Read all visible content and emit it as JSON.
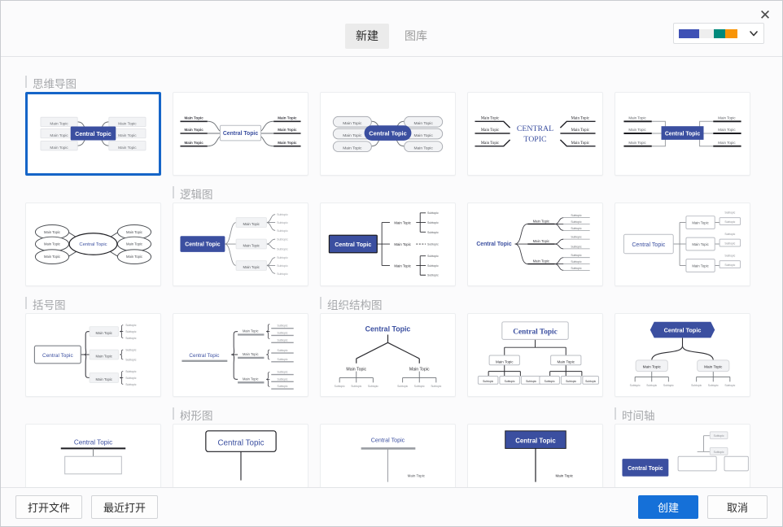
{
  "window": {
    "close_label": "✕"
  },
  "header": {
    "tabs": [
      {
        "label": "新建",
        "active": true
      },
      {
        "label": "图库",
        "active": false
      }
    ],
    "theme_picker": {
      "name": "theme-color-picker",
      "swatches": [
        "#3f51b5",
        "#eeeeee",
        "#00897b",
        "#f89406"
      ],
      "chevron": "⌄"
    }
  },
  "sections": [
    {
      "label": "思维导图"
    },
    {
      "label": "逻辑图"
    },
    {
      "label": "括号图"
    },
    {
      "label": "组织结构图"
    },
    {
      "label": "树形图"
    },
    {
      "label": "时间轴"
    }
  ],
  "labels": {
    "central": "Central Topic",
    "central_upper_line1": "CENTRAL",
    "central_upper_line2": "TOPIC",
    "main": "Main Topic",
    "sub": "Subtopic"
  },
  "colors": {
    "accent_blue": "#3b4fa0",
    "text_blue": "#3b4fa0",
    "primary_button": "#1570d8",
    "selection_border": "#1565c8",
    "node_gray": "#f2f3f5",
    "line_gray": "#8a8d92"
  },
  "templates": {
    "row1": [
      {
        "name": "mindmap-classic-filled",
        "selected": true
      },
      {
        "name": "mindmap-underline-boxed",
        "selected": false
      },
      {
        "name": "mindmap-rounded-pill",
        "selected": false
      },
      {
        "name": "mindmap-serif-plain",
        "selected": false
      },
      {
        "name": "mindmap-orthogonal-underline",
        "selected": false
      }
    ],
    "row2": [
      {
        "name": "logic-ellipse-radial",
        "selected": false
      },
      {
        "name": "logic-right-branch-boxed",
        "selected": false
      },
      {
        "name": "logic-right-branch-square",
        "selected": false
      },
      {
        "name": "logic-right-branch-underline",
        "selected": false
      },
      {
        "name": "logic-right-branch-outline",
        "selected": false
      }
    ],
    "row3": [
      {
        "name": "bracket-boxed",
        "selected": false
      },
      {
        "name": "bracket-underline",
        "selected": false
      },
      {
        "name": "org-plain-topdown",
        "selected": false
      },
      {
        "name": "org-boxed-topdown",
        "selected": false
      },
      {
        "name": "org-filled-hex-topdown",
        "selected": false
      }
    ],
    "row4": [
      {
        "name": "tree-underline-central",
        "selected": false
      },
      {
        "name": "tree-boxed-central",
        "selected": false
      },
      {
        "name": "tree-gray-underline-central",
        "selected": false
      },
      {
        "name": "tree-filled-central",
        "selected": false
      },
      {
        "name": "timeline-filled",
        "selected": false
      }
    ]
  },
  "footer": {
    "open_file_label": "打开文件",
    "recent_label": "最近打开",
    "create_label": "创建",
    "cancel_label": "取消"
  }
}
